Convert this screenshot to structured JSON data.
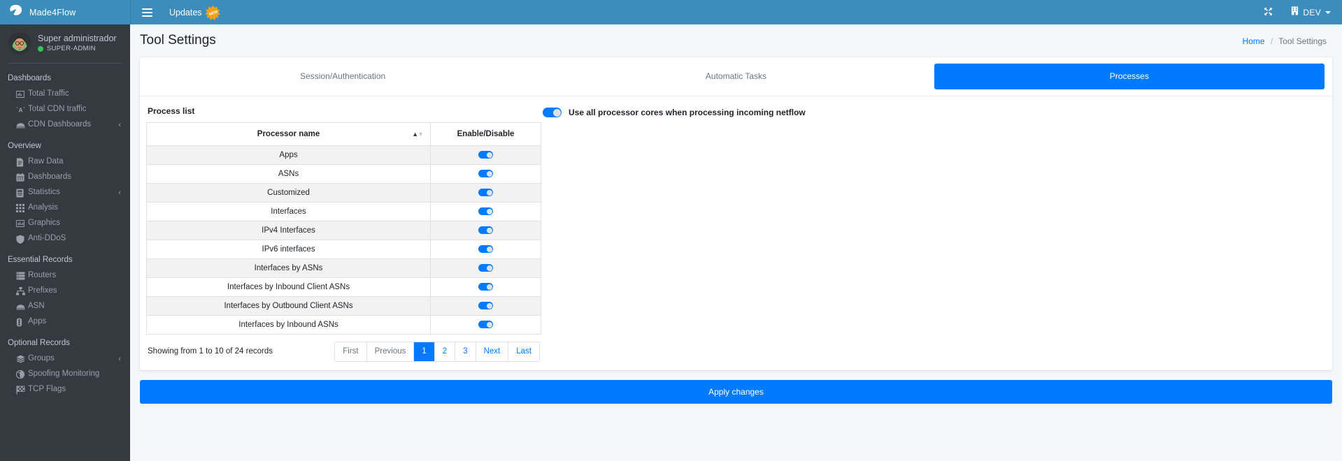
{
  "header": {
    "brand": "Made4Flow",
    "logo_icon": "lightning-bolt-icon",
    "menu_icon": "hamburger-menu-icon",
    "updates_label": "Updates",
    "updates_badge": "NEW",
    "fullscreen_icon": "expand-arrows-icon",
    "env_icon": "building-icon",
    "env_label": "DEV",
    "accent_color": "#3c8dbc"
  },
  "sidebar": {
    "user": {
      "name": "Super administrador",
      "role": "SUPER-ADMIN",
      "status_color": "#37c353",
      "avatar_icon": "user-avatar"
    },
    "sections": [
      {
        "title": "Dashboards",
        "items": [
          {
            "label": "Total Traffic",
            "icon": "bar-chart-icon",
            "chevron": false
          },
          {
            "label": "Total CDN traffic",
            "icon": "cdn-text-icon",
            "chevron": false
          },
          {
            "label": "CDN Dashboards",
            "icon": "cloud-icon",
            "chevron": true
          }
        ]
      },
      {
        "title": "Overview",
        "items": [
          {
            "label": "Raw Data",
            "icon": "document-icon",
            "chevron": false
          },
          {
            "label": "Dashboards",
            "icon": "calendar-icon",
            "chevron": false
          },
          {
            "label": "Statistics",
            "icon": "list-panel-icon",
            "chevron": true
          },
          {
            "label": "Analysis",
            "icon": "grid-icon",
            "chevron": false
          },
          {
            "label": "Graphics",
            "icon": "chart-bars-icon",
            "chevron": false
          },
          {
            "label": "Anti-DDoS",
            "icon": "shield-icon",
            "chevron": false
          }
        ]
      },
      {
        "title": "Essential Records",
        "items": [
          {
            "label": "Routers",
            "icon": "server-icon",
            "chevron": false
          },
          {
            "label": "Prefixes",
            "icon": "sitemap-icon",
            "chevron": false
          },
          {
            "label": "ASN",
            "icon": "network-icon",
            "chevron": false
          },
          {
            "label": "Apps",
            "icon": "traffic-light-icon",
            "chevron": false
          }
        ]
      },
      {
        "title": "Optional Records",
        "items": [
          {
            "label": "Groups",
            "icon": "layers-icon",
            "chevron": true
          },
          {
            "label": "Spoofing Monitoring",
            "icon": "contrast-circle-icon",
            "chevron": false
          },
          {
            "label": "TCP Flags",
            "icon": "checkered-flag-icon",
            "chevron": false
          }
        ]
      }
    ]
  },
  "page": {
    "title": "Tool Settings",
    "breadcrumb_home": "Home",
    "breadcrumb_sep": "/",
    "breadcrumb_current": "Tool Settings"
  },
  "tabs": [
    {
      "label": "Session/Authentication",
      "active": false
    },
    {
      "label": "Automatic Tasks",
      "active": false
    },
    {
      "label": "Processes",
      "active": true
    }
  ],
  "processes": {
    "list_title": "Process list",
    "cores_toggle_label": "Use all processor cores when processing incoming netflow",
    "cores_toggle_on": true,
    "columns": [
      "Processor name",
      "Enable/Disable"
    ],
    "sort_icon": "sort-updown-icon",
    "rows": [
      {
        "name": "Apps",
        "enabled": true
      },
      {
        "name": "ASNs",
        "enabled": true
      },
      {
        "name": "Customized",
        "enabled": true
      },
      {
        "name": "Interfaces",
        "enabled": true
      },
      {
        "name": "IPv4 Interfaces",
        "enabled": true
      },
      {
        "name": "IPv6 interfaces",
        "enabled": true
      },
      {
        "name": "Interfaces by ASNs",
        "enabled": true
      },
      {
        "name": "Interfaces by Inbound Client ASNs",
        "enabled": true
      },
      {
        "name": "Interfaces by Outbound Client ASNs",
        "enabled": true
      },
      {
        "name": "Interfaces by Inbound ASNs",
        "enabled": true
      }
    ],
    "showing_text": "Showing from 1 to 10 of 24 records",
    "pagination": [
      {
        "label": "First",
        "state": "disabled"
      },
      {
        "label": "Previous",
        "state": "disabled"
      },
      {
        "label": "1",
        "state": "active"
      },
      {
        "label": "2",
        "state": "normal"
      },
      {
        "label": "3",
        "state": "normal"
      },
      {
        "label": "Next",
        "state": "normal"
      },
      {
        "label": "Last",
        "state": "normal"
      }
    ],
    "apply_label": "Apply changes"
  }
}
